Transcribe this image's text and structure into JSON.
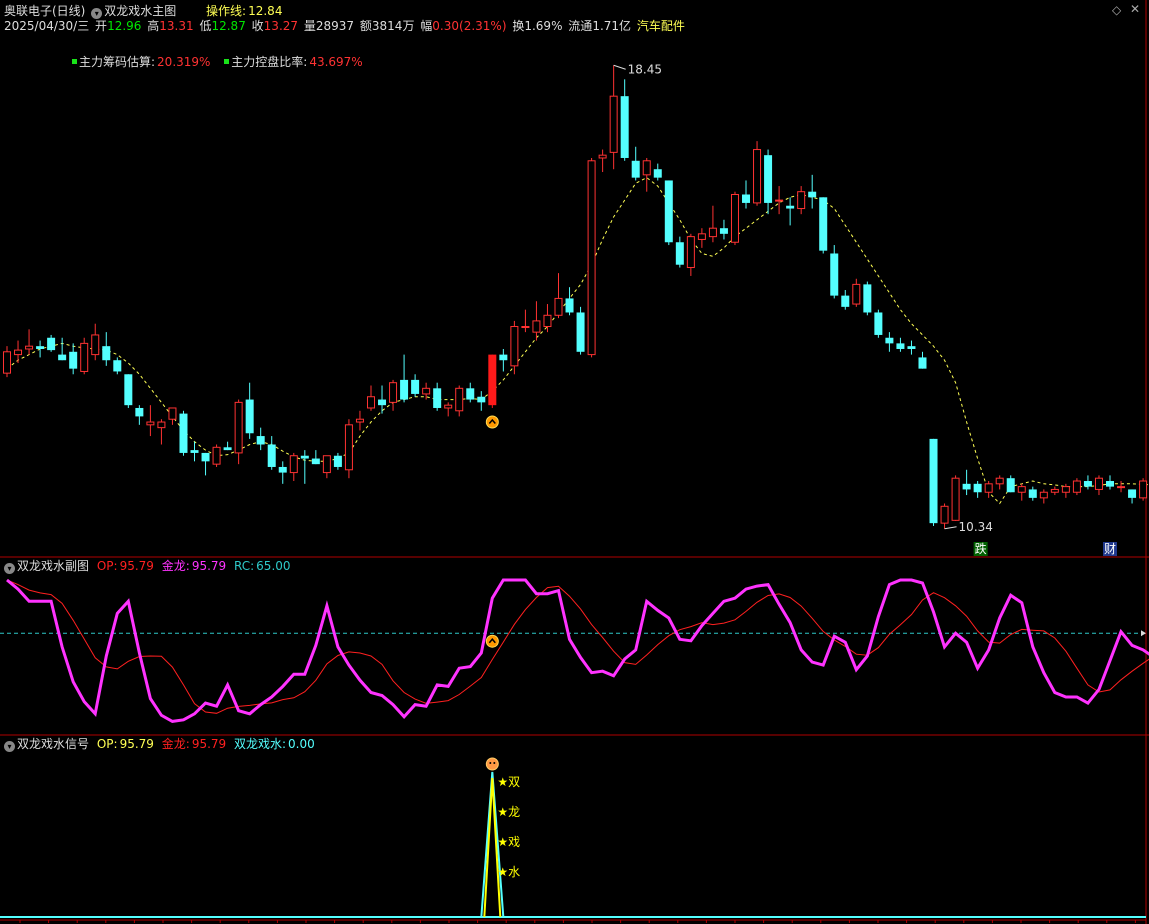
{
  "colors": {
    "up": "#ff3232",
    "down": "#54ffff",
    "ma": "#ffff54",
    "border": "#b00000",
    "op": "#ff2020",
    "gold": "#ff33ff",
    "rc": "#2ec8c8",
    "signal_yellow": "#ffff00",
    "signal_cyan": "#54ffff"
  },
  "header": {
    "stock": "奥联电子(日线)",
    "indicator": "双龙戏水主图",
    "op_line_label": "操作线:",
    "op_line_value": "12.84",
    "date": "2025/04/30/三",
    "open_label": "开",
    "open": "12.96",
    "high_label": "高",
    "high": "13.31",
    "low_label": "低",
    "low": "12.87",
    "close_label": "收",
    "close": "13.27",
    "volume_label": "量",
    "volume": "28937",
    "amount_label": "额",
    "amount": "3814万",
    "change_label": "幅",
    "change": "0.30(2.31%)",
    "turnover_label": "换",
    "turnover": "1.69%",
    "float_label": "流通",
    "float": "1.71亿",
    "sector": "汽车配件"
  },
  "legend": {
    "chip_label": "主力筹码估算:",
    "chip_value": "20.319%",
    "control_label": "主力控盘比率:",
    "control_value": "43.697%"
  },
  "sub1": {
    "title": "双龙戏水副图",
    "op_label": "OP:",
    "op_value": "95.79",
    "gold_label": "金龙:",
    "gold_value": "95.79",
    "rc_label": "RC:",
    "rc_value": "65.00"
  },
  "sub2": {
    "title": "双龙戏水信号",
    "op_label": "OP:",
    "op_value": "95.79",
    "gold_label": "金龙:",
    "gold_value": "95.79",
    "sl_label": "双龙戏水:",
    "sl_value": "0.00",
    "stars": [
      "★双",
      "★龙",
      "★戏",
      "★水"
    ]
  },
  "chart_data": [
    {
      "type": "candlestick",
      "title": "双龙戏水主图",
      "ylim": [
        10.0,
        18.9
      ],
      "max_label": "18.45",
      "min_label": "10.34",
      "markers": [
        "跌",
        "财"
      ],
      "candles": [
        {
          "o": 12.97,
          "h": 13.45,
          "l": 12.9,
          "c": 13.35
        },
        {
          "o": 13.3,
          "h": 13.55,
          "l": 13.15,
          "c": 13.38
        },
        {
          "o": 13.4,
          "h": 13.75,
          "l": 13.3,
          "c": 13.45
        },
        {
          "o": 13.45,
          "h": 13.55,
          "l": 13.25,
          "c": 13.4
        },
        {
          "o": 13.6,
          "h": 13.65,
          "l": 13.35,
          "c": 13.38
        },
        {
          "o": 13.3,
          "h": 13.6,
          "l": 13.2,
          "c": 13.2
        },
        {
          "o": 13.35,
          "h": 13.5,
          "l": 12.95,
          "c": 13.05
        },
        {
          "o": 13.0,
          "h": 13.6,
          "l": 12.95,
          "c": 13.5
        },
        {
          "o": 13.3,
          "h": 13.85,
          "l": 13.2,
          "c": 13.65
        },
        {
          "o": 13.45,
          "h": 13.7,
          "l": 13.1,
          "c": 13.2
        },
        {
          "o": 13.2,
          "h": 13.25,
          "l": 12.95,
          "c": 13.0
        },
        {
          "o": 12.95,
          "h": 12.95,
          "l": 12.35,
          "c": 12.4
        },
        {
          "o": 12.35,
          "h": 12.4,
          "l": 12.05,
          "c": 12.2
        },
        {
          "o": 12.05,
          "h": 12.4,
          "l": 11.85,
          "c": 12.1
        },
        {
          "o": 12.0,
          "h": 12.15,
          "l": 11.7,
          "c": 12.1
        },
        {
          "o": 12.15,
          "h": 12.35,
          "l": 12.05,
          "c": 12.35
        },
        {
          "o": 12.25,
          "h": 12.3,
          "l": 11.5,
          "c": 11.55
        },
        {
          "o": 11.6,
          "h": 11.75,
          "l": 11.4,
          "c": 11.55
        },
        {
          "o": 11.55,
          "h": 11.55,
          "l": 11.15,
          "c": 11.4
        },
        {
          "o": 11.35,
          "h": 11.7,
          "l": 11.3,
          "c": 11.65
        },
        {
          "o": 11.65,
          "h": 11.75,
          "l": 11.6,
          "c": 11.6
        },
        {
          "o": 11.55,
          "h": 12.5,
          "l": 11.35,
          "c": 12.45
        },
        {
          "o": 12.5,
          "h": 12.8,
          "l": 11.8,
          "c": 11.9
        },
        {
          "o": 11.85,
          "h": 12.0,
          "l": 11.6,
          "c": 11.7
        },
        {
          "o": 11.7,
          "h": 11.85,
          "l": 11.25,
          "c": 11.3
        },
        {
          "o": 11.3,
          "h": 11.4,
          "l": 11.0,
          "c": 11.2
        },
        {
          "o": 11.2,
          "h": 11.55,
          "l": 11.05,
          "c": 11.5
        },
        {
          "o": 11.5,
          "h": 11.6,
          "l": 11.0,
          "c": 11.45
        },
        {
          "o": 11.45,
          "h": 11.6,
          "l": 11.35,
          "c": 11.35
        },
        {
          "o": 11.2,
          "h": 11.5,
          "l": 11.1,
          "c": 11.5
        },
        {
          "o": 11.5,
          "h": 11.55,
          "l": 11.25,
          "c": 11.3
        },
        {
          "o": 11.25,
          "h": 12.15,
          "l": 11.1,
          "c": 12.05
        },
        {
          "o": 12.1,
          "h": 12.3,
          "l": 11.95,
          "c": 12.15
        },
        {
          "o": 12.35,
          "h": 12.75,
          "l": 12.3,
          "c": 12.55
        },
        {
          "o": 12.5,
          "h": 12.75,
          "l": 12.25,
          "c": 12.4
        },
        {
          "o": 12.45,
          "h": 12.85,
          "l": 12.3,
          "c": 12.8
        },
        {
          "o": 12.85,
          "h": 13.3,
          "l": 12.45,
          "c": 12.5
        },
        {
          "o": 12.85,
          "h": 12.95,
          "l": 12.55,
          "c": 12.6
        },
        {
          "o": 12.6,
          "h": 12.8,
          "l": 12.5,
          "c": 12.7
        },
        {
          "o": 12.7,
          "h": 12.8,
          "l": 12.3,
          "c": 12.35
        },
        {
          "o": 12.35,
          "h": 12.45,
          "l": 12.2,
          "c": 12.4
        },
        {
          "o": 12.3,
          "h": 12.75,
          "l": 12.2,
          "c": 12.7
        },
        {
          "o": 12.7,
          "h": 12.8,
          "l": 12.45,
          "c": 12.5
        },
        {
          "o": 12.55,
          "h": 12.65,
          "l": 12.3,
          "c": 12.45
        },
        {
          "o": 12.4,
          "h": 13.3,
          "l": 12.35,
          "c": 13.3
        },
        {
          "o": 13.3,
          "h": 13.4,
          "l": 13.0,
          "c": 13.2
        },
        {
          "o": 13.1,
          "h": 13.9,
          "l": 12.95,
          "c": 13.8
        },
        {
          "o": 13.8,
          "h": 14.1,
          "l": 13.7,
          "c": 13.8
        },
        {
          "o": 13.7,
          "h": 14.25,
          "l": 13.55,
          "c": 13.9
        },
        {
          "o": 13.8,
          "h": 14.2,
          "l": 13.7,
          "c": 14.0
        },
        {
          "o": 14.0,
          "h": 14.75,
          "l": 13.95,
          "c": 14.3
        },
        {
          "o": 14.3,
          "h": 14.5,
          "l": 14.0,
          "c": 14.05
        },
        {
          "o": 14.05,
          "h": 14.15,
          "l": 13.3,
          "c": 13.35
        },
        {
          "o": 13.3,
          "h": 16.8,
          "l": 13.25,
          "c": 16.75
        },
        {
          "o": 16.8,
          "h": 16.95,
          "l": 16.55,
          "c": 16.85
        },
        {
          "o": 16.9,
          "h": 18.45,
          "l": 16.6,
          "c": 17.9
        },
        {
          "o": 17.9,
          "h": 18.2,
          "l": 16.75,
          "c": 16.8
        },
        {
          "o": 16.75,
          "h": 17.0,
          "l": 16.4,
          "c": 16.45
        },
        {
          "o": 16.5,
          "h": 16.8,
          "l": 16.2,
          "c": 16.75
        },
        {
          "o": 16.6,
          "h": 16.7,
          "l": 16.4,
          "c": 16.45
        },
        {
          "o": 16.4,
          "h": 16.4,
          "l": 15.25,
          "c": 15.3
        },
        {
          "o": 15.3,
          "h": 15.4,
          "l": 14.85,
          "c": 14.9
        },
        {
          "o": 14.85,
          "h": 15.45,
          "l": 14.7,
          "c": 15.4
        },
        {
          "o": 15.35,
          "h": 15.55,
          "l": 15.2,
          "c": 15.45
        },
        {
          "o": 15.4,
          "h": 15.95,
          "l": 15.3,
          "c": 15.55
        },
        {
          "o": 15.55,
          "h": 15.7,
          "l": 15.35,
          "c": 15.45
        },
        {
          "o": 15.3,
          "h": 16.2,
          "l": 15.25,
          "c": 16.15
        },
        {
          "o": 16.15,
          "h": 16.4,
          "l": 15.9,
          "c": 16.0
        },
        {
          "o": 16.0,
          "h": 17.1,
          "l": 15.95,
          "c": 16.95
        },
        {
          "o": 16.85,
          "h": 16.95,
          "l": 15.8,
          "c": 16.0
        },
        {
          "o": 16.05,
          "h": 16.3,
          "l": 15.8,
          "c": 16.05
        },
        {
          "o": 15.95,
          "h": 16.1,
          "l": 15.6,
          "c": 15.9
        },
        {
          "o": 15.9,
          "h": 16.3,
          "l": 15.8,
          "c": 16.2
        },
        {
          "o": 16.2,
          "h": 16.5,
          "l": 15.9,
          "c": 16.1
        },
        {
          "o": 16.1,
          "h": 16.1,
          "l": 15.1,
          "c": 15.15
        },
        {
          "o": 15.1,
          "h": 15.25,
          "l": 14.3,
          "c": 14.35
        },
        {
          "o": 14.35,
          "h": 14.45,
          "l": 14.1,
          "c": 14.15
        },
        {
          "o": 14.2,
          "h": 14.65,
          "l": 14.15,
          "c": 14.55
        },
        {
          "o": 14.55,
          "h": 14.6,
          "l": 14.0,
          "c": 14.05
        },
        {
          "o": 14.05,
          "h": 14.1,
          "l": 13.6,
          "c": 13.65
        },
        {
          "o": 13.6,
          "h": 13.7,
          "l": 13.35,
          "c": 13.5
        },
        {
          "o": 13.5,
          "h": 13.6,
          "l": 13.35,
          "c": 13.4
        },
        {
          "o": 13.45,
          "h": 13.55,
          "l": 13.3,
          "c": 13.4
        },
        {
          "o": 13.25,
          "h": 13.35,
          "l": 13.05,
          "c": 13.05
        },
        {
          "o": 11.8,
          "h": 11.8,
          "l": 10.25,
          "c": 10.3
        },
        {
          "o": 10.3,
          "h": 10.65,
          "l": 10.2,
          "c": 10.6
        },
        {
          "o": 10.35,
          "h": 11.15,
          "l": 10.34,
          "c": 11.1
        },
        {
          "o": 11.0,
          "h": 11.25,
          "l": 10.8,
          "c": 10.9
        },
        {
          "o": 11.0,
          "h": 11.05,
          "l": 10.75,
          "c": 10.85
        },
        {
          "o": 10.85,
          "h": 11.05,
          "l": 10.75,
          "c": 11.0
        },
        {
          "o": 11.0,
          "h": 11.15,
          "l": 10.9,
          "c": 11.1
        },
        {
          "o": 11.1,
          "h": 11.15,
          "l": 10.85,
          "c": 10.85
        },
        {
          "o": 10.85,
          "h": 11.0,
          "l": 10.7,
          "c": 10.95
        },
        {
          "o": 10.9,
          "h": 10.95,
          "l": 10.7,
          "c": 10.75
        },
        {
          "o": 10.75,
          "h": 10.9,
          "l": 10.65,
          "c": 10.85
        },
        {
          "o": 10.85,
          "h": 10.95,
          "l": 10.8,
          "c": 10.9
        },
        {
          "o": 10.85,
          "h": 11.0,
          "l": 10.75,
          "c": 10.95
        },
        {
          "o": 10.85,
          "h": 11.1,
          "l": 10.8,
          "c": 11.05
        },
        {
          "o": 11.05,
          "h": 11.15,
          "l": 10.9,
          "c": 10.95
        },
        {
          "o": 10.9,
          "h": 11.15,
          "l": 10.8,
          "c": 11.1
        },
        {
          "o": 11.05,
          "h": 11.15,
          "l": 10.9,
          "c": 10.95
        },
        {
          "o": 10.95,
          "h": 11.05,
          "l": 10.85,
          "c": 10.95
        },
        {
          "o": 10.9,
          "h": 10.9,
          "l": 10.65,
          "c": 10.75
        },
        {
          "o": 10.75,
          "h": 11.1,
          "l": 10.7,
          "c": 11.05
        },
        {
          "o": 10.95,
          "h": 11.3,
          "l": 10.9,
          "c": 11.27
        }
      ],
      "ma_line": [
        13.05,
        13.2,
        13.3,
        13.4,
        13.45,
        13.5,
        13.45,
        13.42,
        13.4,
        13.38,
        13.3,
        13.15,
        12.95,
        12.7,
        12.45,
        12.2,
        11.95,
        11.75,
        11.6,
        11.5,
        11.52,
        11.6,
        11.7,
        11.75,
        11.7,
        11.58,
        11.48,
        11.42,
        11.4,
        11.4,
        11.45,
        11.55,
        11.85,
        12.1,
        12.3,
        12.45,
        12.5,
        12.55,
        12.55,
        12.5,
        12.5,
        12.5,
        12.52,
        12.5,
        12.65,
        12.85,
        13.1,
        13.35,
        13.6,
        13.8,
        14.05,
        14.3,
        14.55,
        14.9,
        15.35,
        15.75,
        16.05,
        16.35,
        16.45,
        16.3,
        16.0,
        15.7,
        15.35,
        15.1,
        15.05,
        15.2,
        15.4,
        15.55,
        15.7,
        15.85,
        16.0,
        16.1,
        16.15,
        16.1,
        16.05,
        15.9,
        15.6,
        15.3,
        15.0,
        14.7,
        14.4,
        14.1,
        13.85,
        13.65,
        13.45,
        13.2,
        12.8,
        12.1,
        11.45,
        10.85,
        10.65,
        10.95,
        11.0,
        11.05,
        11.0,
        10.98,
        10.95,
        10.95,
        10.95,
        10.97,
        11.0,
        11.0,
        11.0,
        10.99,
        10.98,
        10.95,
        10.98,
        11.05
      ]
    },
    {
      "type": "line",
      "title": "双龙戏水副图",
      "ylim": [
        0,
        100
      ],
      "rc_level": 65.0,
      "series": [
        {
          "name": "金龙",
          "values": [
            100,
            94,
            86,
            86,
            86,
            56,
            33,
            20,
            12,
            50,
            78,
            86,
            52,
            22,
            11,
            7,
            8,
            12,
            19,
            17,
            31,
            14,
            12,
            18,
            23,
            30,
            38,
            38,
            57,
            83,
            56,
            44,
            34,
            26,
            24,
            18,
            10,
            18,
            17,
            31,
            30,
            42,
            43,
            52,
            88,
            100,
            100,
            100,
            91,
            91,
            93,
            61,
            49,
            39,
            40,
            37,
            48,
            54,
            86,
            80,
            75,
            61,
            60,
            70,
            78,
            86,
            88,
            94,
            96,
            97,
            84,
            72,
            54,
            46,
            44,
            63,
            59,
            41,
            50,
            76,
            97,
            100,
            100,
            98,
            79,
            56,
            65,
            59,
            42,
            54,
            75,
            90,
            85,
            56,
            39,
            26,
            23,
            23,
            19,
            28,
            47,
            66,
            57,
            54,
            49,
            43,
            77,
            100,
            100
          ]
        },
        {
          "name": "OP",
          "values": [
            100,
            94,
            86,
            86,
            86,
            56,
            33,
            20,
            12,
            50,
            78,
            86,
            52,
            22,
            11,
            7,
            8,
            12,
            19,
            17,
            31,
            14,
            12,
            18,
            23,
            30,
            38,
            38,
            57,
            83,
            56,
            44,
            34,
            26,
            24,
            18,
            10,
            18,
            17,
            31,
            30,
            42,
            43,
            52,
            88,
            100,
            100,
            100,
            91,
            91,
            93,
            61,
            49,
            39,
            40,
            37,
            48,
            54,
            86,
            80,
            75,
            61,
            60,
            70,
            78,
            86,
            88,
            94,
            96,
            97,
            84,
            72,
            54,
            46,
            44,
            63,
            59,
            41,
            50,
            76,
            97,
            100,
            100,
            98,
            79,
            56,
            65,
            59,
            42,
            54,
            75,
            90,
            85,
            56,
            39,
            26,
            23,
            23,
            19,
            28,
            47,
            66,
            57,
            54,
            49,
            43,
            77,
            100,
            100
          ]
        }
      ]
    }
  ]
}
